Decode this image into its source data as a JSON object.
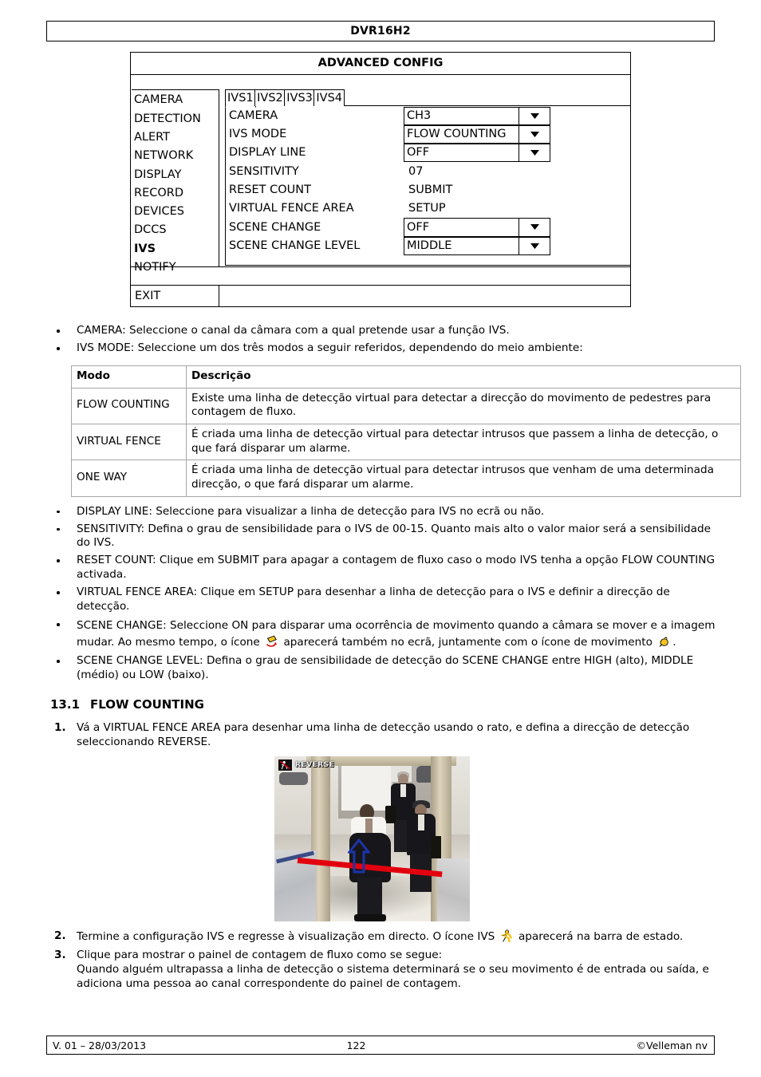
{
  "header": {
    "title": "DVR16H2"
  },
  "osd": {
    "title": "ADVANCED CONFIG",
    "menu": [
      {
        "label": "CAMERA",
        "active": false
      },
      {
        "label": "DETECTION",
        "active": false
      },
      {
        "label": "ALERT",
        "active": false
      },
      {
        "label": "NETWORK",
        "active": false
      },
      {
        "label": "DISPLAY",
        "active": false
      },
      {
        "label": "RECORD",
        "active": false
      },
      {
        "label": "DEVICES",
        "active": false
      },
      {
        "label": "DCCS",
        "active": false
      },
      {
        "label": "IVS",
        "active": true
      },
      {
        "label": "NOTIFY",
        "active": false
      }
    ],
    "tabs": [
      {
        "label": "IVS1",
        "active": true
      },
      {
        "label": "IVS2",
        "active": false
      },
      {
        "label": "IVS3",
        "active": false
      },
      {
        "label": "IVS4",
        "active": false
      }
    ],
    "fields": [
      {
        "label": "CAMERA",
        "value": "CH3",
        "type": "dropdown"
      },
      {
        "label": "IVS MODE",
        "value": "FLOW COUNTING",
        "type": "dropdown"
      },
      {
        "label": "DISPLAY LINE",
        "value": "OFF",
        "type": "dropdown"
      },
      {
        "label": "SENSITIVITY",
        "value": "07",
        "type": "text"
      },
      {
        "label": "RESET COUNT",
        "value": "SUBMIT",
        "type": "text"
      },
      {
        "label": "VIRTUAL FENCE AREA",
        "value": "SETUP",
        "type": "text"
      },
      {
        "label": "SCENE CHANGE",
        "value": "OFF",
        "type": "dropdown"
      },
      {
        "label": "SCENE CHANGE LEVEL",
        "value": "MIDDLE",
        "type": "dropdown"
      }
    ],
    "exit_label": "EXIT"
  },
  "bullets_top": [
    "CAMERA: Seleccione o canal da câmara com a qual pretende usar a função IVS.",
    "IVS MODE: Seleccione um dos três modos a seguir referidos, dependendo do meio ambiente:"
  ],
  "modes_table": {
    "headers": [
      "Modo",
      "Descrição"
    ],
    "rows": [
      {
        "mode": "FLOW COUNTING",
        "desc": "Existe uma linha de detecção virtual para detectar a direcção do movimento de pedestres para contagem de fluxo."
      },
      {
        "mode": "VIRTUAL FENCE",
        "desc": "É criada uma linha de detecção virtual para detectar intrusos que passem a linha de detecção, o que fará disparar um alarme."
      },
      {
        "mode": "ONE WAY",
        "desc": "É criada uma linha de detecção virtual para detectar intrusos que venham de uma determinada direcção, o que fará disparar um alarme."
      }
    ]
  },
  "bullets_bottom": {
    "display_line": "DISPLAY LINE: Seleccione para visualizar a linha de detecção para IVS no ecrã ou não.",
    "sensitivity": "SENSITIVITY: Defina o grau de sensibilidade para o IVS de 00-15. Quanto mais alto o valor maior será a sensibilidade do IVS.",
    "reset_count": "RESET COUNT: Clique em SUBMIT para apagar a contagem de fluxo caso o modo IVS tenha a opção FLOW COUNTING activada.",
    "virtual_fence_area": "VIRTUAL FENCE AREA: Clique em SETUP para desenhar a linha de detecção para o IVS e definir a direcção de detecção.",
    "scene_change_part1": "SCENE CHANGE: Seleccione ON para disparar uma ocorrência de movimento quando a câmara se mover e a imagem mudar. Ao mesmo tempo, o ícone",
    "scene_change_part2": "aparecerá também no ecrã, juntamente com o ícone de movimento",
    "scene_change_part3": ".",
    "scene_change_level": "SCENE CHANGE LEVEL: Defina o grau de sensibilidade de detecção do SCENE CHANGE entre HIGH (alto), MIDDLE (médio) ou LOW (baixo)."
  },
  "section": {
    "number": "13.1",
    "title": "FLOW COUNTING"
  },
  "steps": {
    "one_num": "1.",
    "one_text": "Vá a VIRTUAL FENCE AREA para desenhar uma linha de detecção usando o rato, e defina a direcção de detecção seleccionando REVERSE.",
    "two_num": "2.",
    "two_part1": "Termine a configuração IVS e regresse à visualização em directo. O ícone IVS",
    "two_part2": "aparecerá na barra de estado.",
    "three_num": "3.",
    "three_line1": "Clique para mostrar o painel de contagem de fluxo como se segue:",
    "three_line2": "Quando alguém ultrapassa a linha de detecção o sistema determinará se o seu movimento é de entrada ou saída, e adiciona uma pessoa ao canal correspondente do painel de contagem."
  },
  "photo": {
    "osd_badge_label": "REVERSE",
    "detection_line_color": "#e2000f",
    "direction_arrow_color": "#1b35a8"
  },
  "footer": {
    "version": "V. 01 – 28/03/2013",
    "page": "122",
    "copyright": "©Velleman nv"
  },
  "icons": {
    "scene_change": "scene-change-icon",
    "motion": "motion-icon",
    "ivs": "ivs-running-person-icon"
  }
}
